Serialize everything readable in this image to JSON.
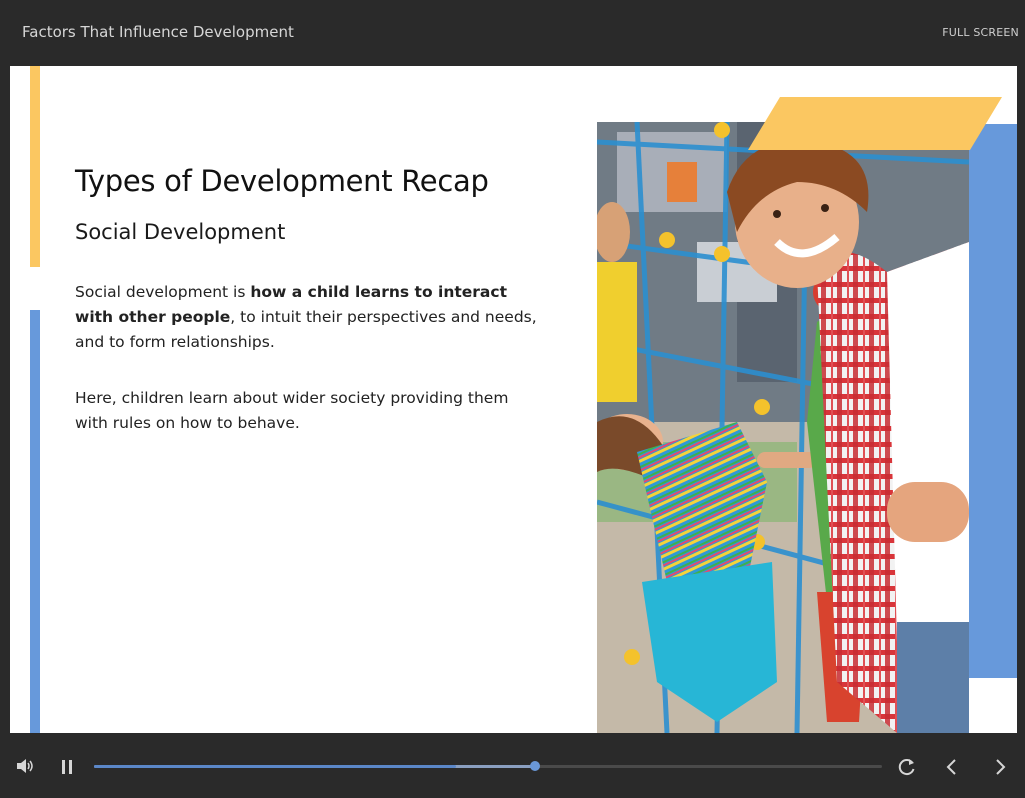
{
  "header": {
    "title": "Factors That Influence Development",
    "fullscreen_label": "FULL SCREEN"
  },
  "slide": {
    "heading": "Types of Development Recap",
    "subheading": "Social Development",
    "p1": {
      "t1": "Social development is ",
      "b1": "how a child learns to interact with other people",
      "t2": ", to intuit their perspectives and needs, and to form relationships."
    },
    "p2": "Here, children learn about wider society providing them with rules on how to behave.",
    "image_alt": "children playing on rope climbing frame"
  },
  "player": {
    "progress": 0.56,
    "buffered": 0.46
  },
  "colors": {
    "accent_blue": "#6799db",
    "accent_yellow": "#fbc761",
    "chrome": "#2a2a2a"
  },
  "icons": {
    "volume": "volume-icon",
    "pause": "pause-icon",
    "replay": "replay-icon",
    "prev": "chevron-left-icon",
    "next": "chevron-right-icon"
  }
}
